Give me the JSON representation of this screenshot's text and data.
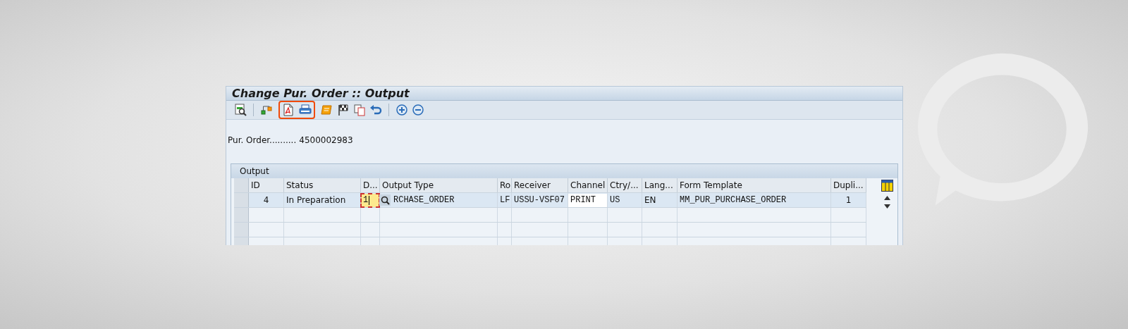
{
  "window": {
    "title": "Change Pur. Order :: Output"
  },
  "toolbar": [
    {
      "highlighted": false,
      "items": [
        {
          "kind": "find"
        },
        {
          "kind": "separator"
        },
        {
          "kind": "network"
        }
      ]
    },
    {
      "highlighted": true,
      "items": [
        {
          "kind": "pdf"
        },
        {
          "kind": "print"
        }
      ]
    },
    {
      "highlighted": false,
      "items": [
        {
          "kind": "scroll"
        },
        {
          "kind": "flag"
        },
        {
          "kind": "copy"
        },
        {
          "kind": "undo"
        },
        {
          "kind": "separator"
        },
        {
          "kind": "add"
        },
        {
          "kind": "remove"
        }
      ]
    }
  ],
  "header": {
    "label": "Pur. Order..........",
    "value": "4500002983"
  },
  "table": {
    "title": "Output",
    "columns": [
      "ID",
      "Status",
      "D...",
      "Output Type",
      "Ro",
      "Receiver",
      "Channel",
      "Ctry/...",
      "Lang...",
      "Form Template",
      "Dupli..."
    ],
    "rows": [
      {
        "selected": true,
        "cells": [
          {
            "kind": "number",
            "text": "4"
          },
          {
            "kind": "text",
            "text": "In Preparation"
          },
          {
            "kind": "input",
            "text": "1",
            "focused": true,
            "value_help": true
          },
          {
            "kind": "mono",
            "text": "RCHASE_ORDER"
          },
          {
            "kind": "mono",
            "text": "LF"
          },
          {
            "kind": "mono",
            "text": "USSU-VSF07"
          },
          {
            "kind": "input",
            "text": "PRINT",
            "focused": false,
            "value_help": false
          },
          {
            "kind": "mono",
            "text": "US"
          },
          {
            "kind": "text",
            "text": "EN"
          },
          {
            "kind": "mono",
            "text": "MM_PUR_PURCHASE_ORDER"
          },
          {
            "kind": "number",
            "text": "1"
          }
        ]
      }
    ]
  }
}
